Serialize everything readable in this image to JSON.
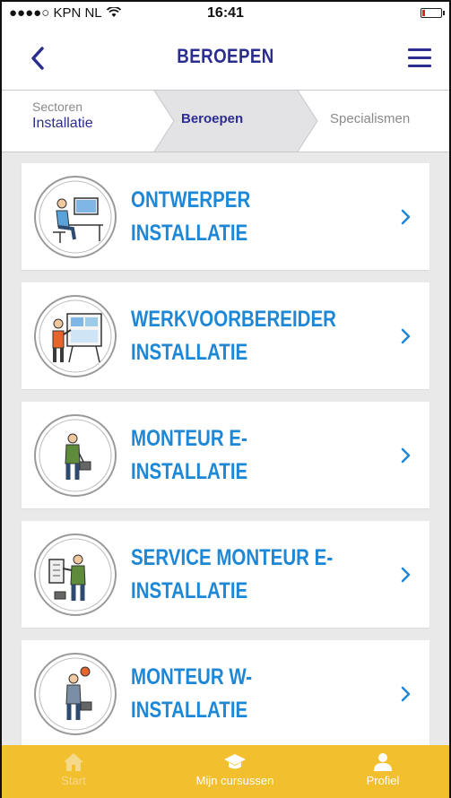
{
  "status_bar": {
    "carrier": "●●●●○ KPN NL",
    "time": "16:41"
  },
  "nav": {
    "title": "BEROEPEN"
  },
  "breadcrumb": {
    "sectoren_label": "Sectoren",
    "sectoren_value": "Installatie",
    "beroepen_label": "Beroepen",
    "specialismen_label": "Specialismen"
  },
  "professions": [
    {
      "title": "ONTWERPER INSTALLATIE",
      "icon": "person-at-computer-icon"
    },
    {
      "title": "WERKVOORBEREIDER INSTALLATIE",
      "icon": "person-at-whiteboard-icon"
    },
    {
      "title": "MONTEUR E-INSTALLATIE",
      "icon": "electrician-with-toolbox-icon"
    },
    {
      "title": "SERVICE MONTEUR E-INSTALLATIE",
      "icon": "technician-at-panel-icon"
    },
    {
      "title": "MONTEUR W-INSTALLATIE",
      "icon": "plumber-with-toolbox-icon"
    }
  ],
  "tab_bar": {
    "start": "Start",
    "courses": "Mijn cursussen",
    "profile": "Profiel"
  },
  "colors": {
    "brand_navy": "#2b2d8f",
    "item_blue": "#1e87d6",
    "tab_yellow": "#f2bf2e",
    "background": "#e9e9ea"
  }
}
